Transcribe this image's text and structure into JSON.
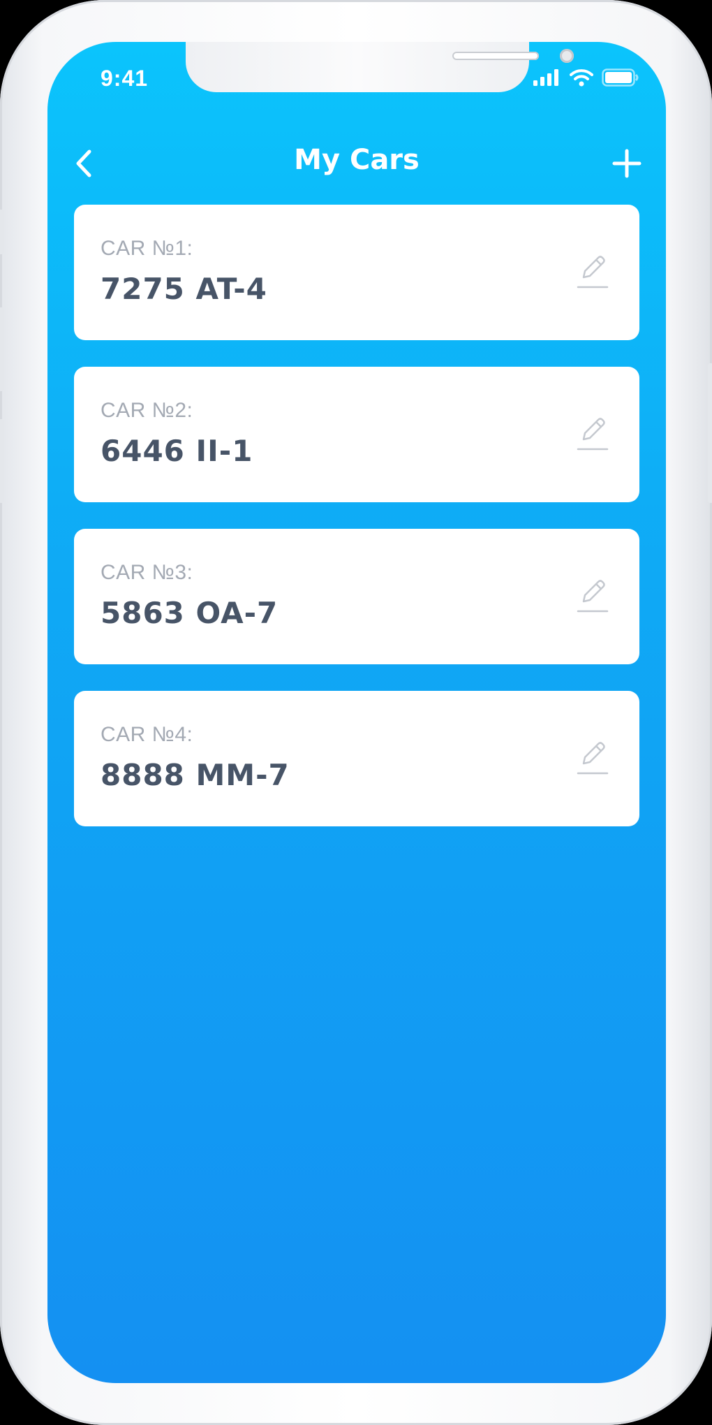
{
  "status_bar": {
    "time": "9:41",
    "icons": [
      "signal-icon",
      "wifi-icon",
      "battery-icon"
    ]
  },
  "header": {
    "title": "My Cars",
    "back_icon": "chevron-left-icon",
    "add_icon": "plus-icon"
  },
  "cars": [
    {
      "label": "CAR №1:",
      "plate": "7275 AT-4"
    },
    {
      "label": "CAR №2:",
      "plate": "6446 II-1"
    },
    {
      "label": "CAR №3:",
      "plate": "5863 OA-7"
    },
    {
      "label": "CAR №4:",
      "plate": "8888 MM-7"
    }
  ],
  "colors": {
    "gradient_top": "#0bc4fc",
    "gradient_bottom": "#1490f2",
    "card_background": "#ffffff",
    "label_color": "#a3a9b3",
    "plate_color": "#475467",
    "edit_icon_color": "#c4c8cf"
  }
}
